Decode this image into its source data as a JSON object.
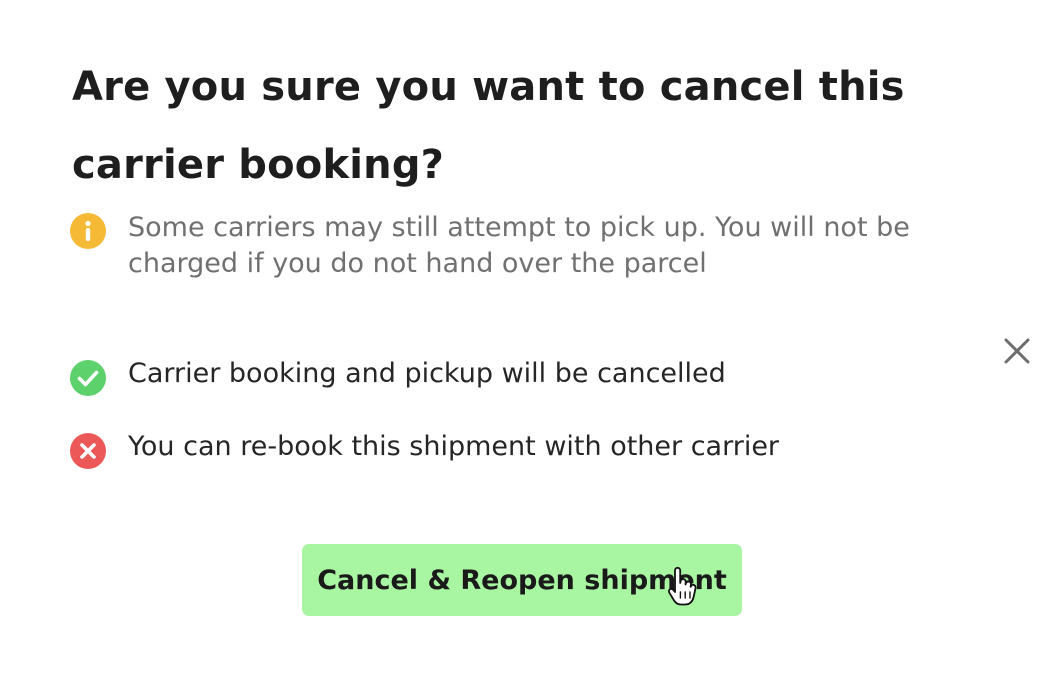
{
  "dialog": {
    "title": "Are you sure you want to cancel this carrier booking?",
    "warning": {
      "icon": "info-icon",
      "color": "#F5B935",
      "text": "Some carriers may still attempt to pick up. You will not be charged if you do not hand over the parcel"
    },
    "items": [
      {
        "icon": "check-circle-icon",
        "color": "#5DD16B",
        "text": "Carrier booking and pickup will be cancelled"
      },
      {
        "icon": "x-circle-icon",
        "color": "#EC5757",
        "text": "You can re-book this shipment with other carrier"
      }
    ],
    "close_icon": "close-icon",
    "primary_button": {
      "label": "Cancel & Reopen shipment",
      "color": "#A8F5A2"
    }
  }
}
